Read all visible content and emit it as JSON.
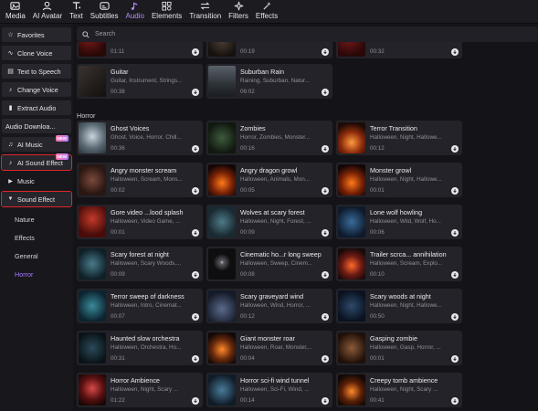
{
  "toolbar": {
    "items": [
      {
        "label": "Media",
        "icon": "media-icon"
      },
      {
        "label": "AI Avatar",
        "icon": "avatar-icon"
      },
      {
        "label": "Text",
        "icon": "text-icon"
      },
      {
        "label": "Subtitles",
        "icon": "subtitles-icon"
      },
      {
        "label": "Audio",
        "icon": "music-note-icon"
      },
      {
        "label": "Elements",
        "icon": "elements-icon"
      },
      {
        "label": "Transition",
        "icon": "transition-icon"
      },
      {
        "label": "Filters",
        "icon": "filters-icon"
      },
      {
        "label": "Effects",
        "icon": "effects-icon"
      }
    ],
    "active": "Audio",
    "active_color": "#b88cff"
  },
  "sidebar": {
    "items": [
      {
        "label": "Favorites",
        "icon": "star-icon"
      },
      {
        "label": "Clone Voice",
        "icon": "clone-voice-icon"
      },
      {
        "label": "Text to Speech",
        "icon": "text-to-speech-icon"
      },
      {
        "label": "Change Voice",
        "icon": "change-voice-icon"
      },
      {
        "label": "Extract Audio",
        "icon": "extract-audio-icon"
      },
      {
        "label": "Audio Downloa...",
        "icon": "download-icon"
      },
      {
        "label": "AI Music",
        "icon": "ai-music-icon",
        "badge": "NEW"
      },
      {
        "label": "AI Sound Effect",
        "icon": "ai-sound-icon",
        "badge": "NEW"
      },
      {
        "label": "Music",
        "icon": "caret-right-icon"
      },
      {
        "label": "Sound Effect",
        "icon": "caret-down-icon"
      }
    ],
    "sub_items": [
      "Nature",
      "Effects",
      "General",
      "Horror"
    ],
    "selected_sub": "Horror",
    "highlight_color": "#e0262a"
  },
  "search": {
    "placeholder": "Search"
  },
  "top_partial": [
    {
      "duration": "01:11"
    },
    {
      "duration": "00:19"
    },
    {
      "duration": "00:32"
    }
  ],
  "prev_section": [
    {
      "title": "Guitar",
      "tags": "Guitar, Instrument, Strings...",
      "duration": "00:38"
    },
    {
      "title": "Suburban Rain",
      "tags": "Raining, Suburban, Natur...",
      "duration": "06:02"
    }
  ],
  "section_title": "Horror",
  "cards": [
    {
      "title": "Ghost Voices",
      "tags": "Ghost, Voice, Horror, Chill...",
      "duration": "00:36"
    },
    {
      "title": "Zombies",
      "tags": "Horror, Zombies, Monster...",
      "duration": "00:16"
    },
    {
      "title": "Terror Transition",
      "tags": "Halloween, Night, Hallowe...",
      "duration": "00:12"
    },
    {
      "title": "Angry monster scream",
      "tags": "Halloween, Scream, Mons...",
      "duration": "00:02"
    },
    {
      "title": "Angry dragon growl",
      "tags": "Halloween, Animals, Mon...",
      "duration": "00:05"
    },
    {
      "title": "Monster growl",
      "tags": "Halloween, Night, Hallowe...",
      "duration": "00:01"
    },
    {
      "title": "Gore video ...lood splash",
      "tags": "Halloween, Video Game, ...",
      "duration": "00:01"
    },
    {
      "title": "Wolves at scary forest",
      "tags": "Halloween, Night, Forest, ...",
      "duration": "00:09"
    },
    {
      "title": "Lone wolf howling",
      "tags": "Halloween, Wild, Wolf, Ho...",
      "duration": "00:06"
    },
    {
      "title": "Scary forest at night",
      "tags": "Halloween, Scary Woods,...",
      "duration": "00:09"
    },
    {
      "title": "Cinematic ho...r long sweep",
      "tags": "Halloween, Sweep, Cinem...",
      "duration": "00:08"
    },
    {
      "title": "Trailer scrca... annihilation",
      "tags": "Halloween, Scream, Explo...",
      "duration": "00:10"
    },
    {
      "title": "Terror sweep of darkness",
      "tags": "Halloween, Intro, Cinemat...",
      "duration": "00:07"
    },
    {
      "title": "Scary graveyard wind",
      "tags": "Halloween, Wind, Horror, ...",
      "duration": "00:12"
    },
    {
      "title": "Scary woods at night",
      "tags": "Halloween, Night, Hallowe...",
      "duration": "00:50"
    },
    {
      "title": "Haunted slow orchestra",
      "tags": "Halloween, Orchestra, Ho...",
      "duration": "00:31"
    },
    {
      "title": "Giant monster roar",
      "tags": "Halloween, Roar, Monster,...",
      "duration": "00:04"
    },
    {
      "title": "Gasping zombie",
      "tags": "Halloween, Gasp, Horror, ...",
      "duration": "00:01"
    },
    {
      "title": "Horror Ambience",
      "tags": "Halloween, Night, Scary ...",
      "duration": "01:22"
    },
    {
      "title": "Horror sci-fi wind tunnel",
      "tags": "Halloween, Sci-Fi, Wind, ...",
      "duration": "00:14"
    },
    {
      "title": "Creepy tomb ambience",
      "tags": "Halloween, Night, Scary ...",
      "duration": "00:41"
    }
  ]
}
